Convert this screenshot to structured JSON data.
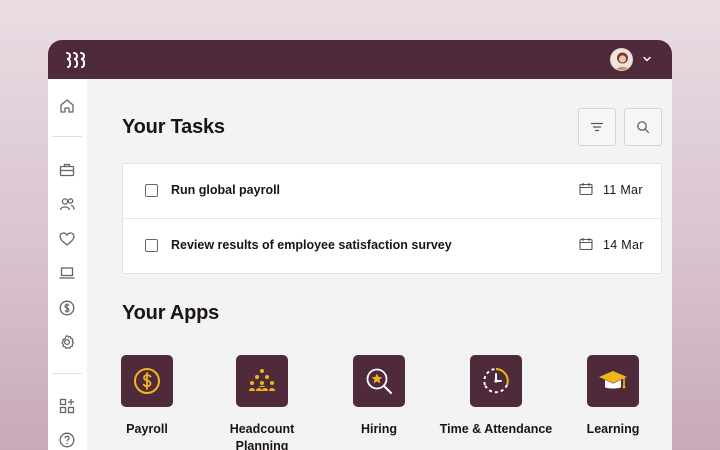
{
  "topbar": {
    "logo_icon": "brand-logo-icon",
    "avatar_icon": "user-avatar",
    "menu_icon": "chevron-down-icon"
  },
  "sidebar": {
    "items": [
      {
        "icon": "home-icon"
      },
      {
        "icon": "briefcase-icon"
      },
      {
        "icon": "people-icon"
      },
      {
        "icon": "heart-icon"
      },
      {
        "icon": "laptop-icon"
      },
      {
        "icon": "dollar-circle-icon"
      },
      {
        "icon": "gear-icon"
      },
      {
        "icon": "add-apps-icon"
      },
      {
        "icon": "help-icon"
      }
    ]
  },
  "tasks": {
    "title": "Your Tasks",
    "filter_icon": "filter-icon",
    "search_icon": "search-icon",
    "items": [
      {
        "label": "Run global payroll",
        "date": "11 Mar",
        "checked": false
      },
      {
        "label": "Review results of employee satisfaction survey",
        "date": "14 Mar",
        "checked": false
      }
    ]
  },
  "apps": {
    "title": "Your Apps",
    "items": [
      {
        "label": "Payroll",
        "icon": "dollar-coin-icon"
      },
      {
        "label": "Headcount Planning",
        "icon": "people-group-icon"
      },
      {
        "label": "Hiring",
        "icon": "star-magnifier-icon"
      },
      {
        "label": "Time & Attendance",
        "icon": "clock-icon"
      },
      {
        "label": "Learning",
        "icon": "graduation-cap-icon"
      }
    ]
  },
  "colors": {
    "brand": "#4f2a3b",
    "accent": "#f2b61b",
    "background": "#f4f3f3"
  }
}
